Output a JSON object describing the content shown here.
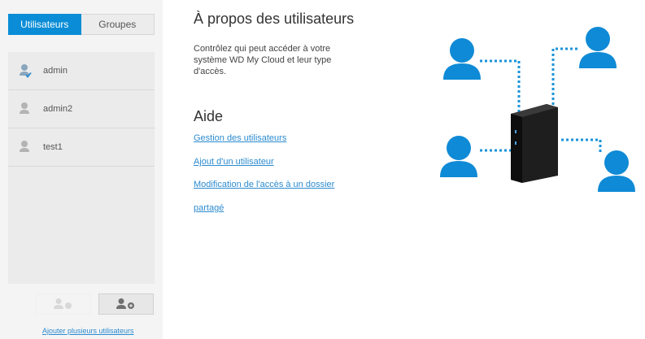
{
  "sidebar": {
    "tabs": [
      {
        "label": "Utilisateurs",
        "active": true
      },
      {
        "label": "Groupes",
        "active": false
      }
    ],
    "users": [
      {
        "name": "admin",
        "icon": "admin-user-icon"
      },
      {
        "name": "admin2",
        "icon": "user-icon"
      },
      {
        "name": "test1",
        "icon": "user-icon"
      }
    ],
    "bulk_add_link": "Ajouter plusieurs utilisateurs"
  },
  "main": {
    "title": "À propos des utilisateurs",
    "description": "Contrôlez qui peut accéder à votre système WD My Cloud et leur type d'accès.",
    "help_title": "Aide",
    "help_links": [
      "Gestion des utilisateurs",
      "Ajout d'un utilisateur",
      "Modification de l'accès à un dossier",
      "partagé"
    ]
  },
  "colors": {
    "accent": "#0a8dd6",
    "link": "#2c8bd0",
    "person": "#0f8ad6",
    "device": "#1a1a1a"
  }
}
